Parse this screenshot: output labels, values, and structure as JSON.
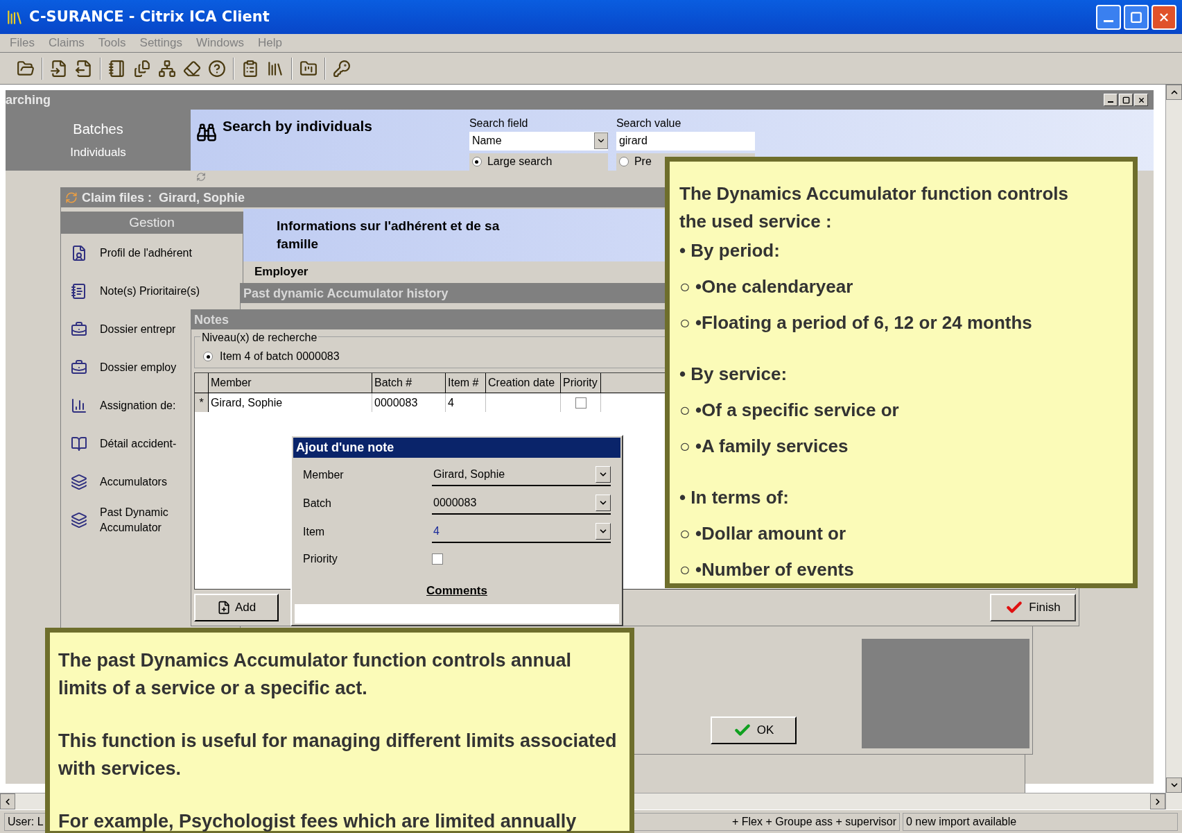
{
  "window": {
    "title": "C-SURANCE - Citrix ICA Client"
  },
  "menu": [
    "Files",
    "Claims",
    "Tools",
    "Settings",
    "Windows",
    "Help"
  ],
  "search_window": {
    "title": "arching",
    "sidebar": [
      {
        "kind": "group",
        "label": "Batches"
      },
      {
        "kind": "item",
        "label": "Individuals"
      }
    ],
    "heading": "Search by individuals",
    "search_field": {
      "label": "Search field",
      "value": "Name"
    },
    "search_value": {
      "label": "Search value",
      "value": "girard"
    },
    "options": [
      {
        "label": "Large search",
        "selected": true
      },
      {
        "label": "Pre",
        "selected": false
      }
    ]
  },
  "claim_window": {
    "title": "Claim files :  Girard, Sophie",
    "sidebar_title": "Gestion",
    "sidebar_items": [
      {
        "kind": "profile",
        "label": "Profil de l'adhérent"
      },
      {
        "kind": "notes",
        "label": "Note(s) Prioritaire(s)"
      },
      {
        "kind": "folder",
        "label": "Dossier entrepr"
      },
      {
        "kind": "folder",
        "label": "Dossier employ"
      },
      {
        "kind": "chart",
        "label": "Assignation de:"
      },
      {
        "kind": "book",
        "label": "Détail accident-"
      },
      {
        "kind": "stack",
        "label": "Accumulators"
      },
      {
        "kind": "stack",
        "label": "Past Dynamic Accumulator"
      }
    ],
    "heading": "Informations sur l'adhérent et de sa famille",
    "group_label": "Employer"
  },
  "history_window": {
    "title": "Past dynamic Accumulator history",
    "ok_button": "OK"
  },
  "notes_window": {
    "title": "Notes",
    "group_label": "Niveau(x) de recherche",
    "levels": [
      {
        "label": "Item 4 of batch 0000083",
        "selected": true
      }
    ],
    "table": {
      "columns": [
        "Member",
        "Batch #",
        "Item #",
        "Creation date",
        "Priority"
      ],
      "rows": [
        {
          "marker": "*",
          "member": "Girard, Sophie",
          "batch": "0000083",
          "item": "4",
          "priority": false
        }
      ]
    },
    "add_button": "Add",
    "finish_button": "Finish"
  },
  "note_dialog": {
    "title": "Ajout d'une note",
    "fields": [
      {
        "kind": "select",
        "label": "Member",
        "value": "Girard, Sophie"
      },
      {
        "kind": "select",
        "label": "Batch",
        "value": "0000083"
      },
      {
        "kind": "select",
        "label": "Item",
        "value": "4"
      },
      {
        "kind": "checkbox",
        "label": "Priority",
        "checked": false
      }
    ],
    "comments_label": "Comments"
  },
  "status_bar": [
    "User: L",
    "+ Flex + Groupe ass + supervisor",
    "0 new import available"
  ],
  "callouts": [
    {
      "lines": [
        {
          "kind": "text",
          "text": "The Dynamics Accumulator function controls the used service :"
        },
        {
          "kind": "bullet",
          "marker": "•",
          "text": "By period:"
        },
        {
          "kind": "sub",
          "marker": "○ •",
          "text": "One calendaryear"
        },
        {
          "kind": "sub",
          "marker": "○ •",
          "text": "Floating a period of 6, 12 or 24 months"
        },
        {
          "kind": "bullet",
          "marker": "•",
          "text": "By service:"
        },
        {
          "kind": "sub",
          "marker": "○ •",
          "text": "Of a specific service or"
        },
        {
          "kind": "sub",
          "marker": "○ •",
          "text": "A family services"
        },
        {
          "kind": "bullet",
          "marker": "•",
          "text": "In terms of:"
        },
        {
          "kind": "sub",
          "marker": "○ •",
          "text": "Dollar amount or"
        },
        {
          "kind": "sub",
          "marker": "○ •",
          "text": "Number of events"
        }
      ]
    },
    {
      "lines": [
        {
          "kind": "text",
          "text": "The past Dynamics Accumulator function controls annual limits of a service or a specific act."
        },
        {
          "kind": "text",
          "text": "This function is useful for managing different limits associated with services."
        },
        {
          "kind": "text",
          "text": "For example, Psychologist fees which are limited annually"
        }
      ]
    }
  ]
}
